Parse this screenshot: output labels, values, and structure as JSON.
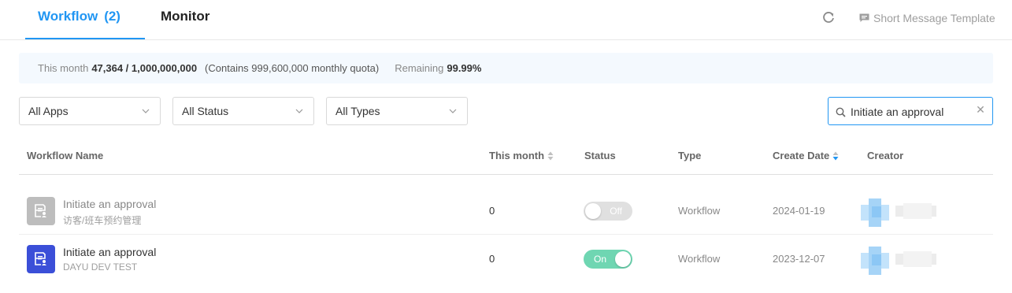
{
  "tabs": {
    "workflow_label": "Workflow",
    "workflow_count": "(2)",
    "monitor_label": "Monitor"
  },
  "header": {
    "short_message_template": "Short Message Template"
  },
  "quota": {
    "this_month_label": "This month",
    "usage": "47,364 / 1,000,000,000",
    "contains": "(Contains 999,600,000 monthly quota)",
    "remaining_label": "Remaining",
    "remaining_value": "99.99%"
  },
  "filters": {
    "apps": "All Apps",
    "status": "All Status",
    "types": "All Types"
  },
  "search": {
    "value": "Initiate an approval"
  },
  "table": {
    "columns": {
      "name": "Workflow Name",
      "this_month": "This month",
      "status": "Status",
      "type": "Type",
      "create_date": "Create Date",
      "creator": "Creator"
    },
    "rows": [
      {
        "name": "Initiate an approval",
        "app": "访客/班车预约管理",
        "count": "0",
        "status": "Off",
        "type": "Workflow",
        "date": "2024-01-19"
      },
      {
        "name": "Initiate an approval",
        "app": "DAYU DEV TEST",
        "count": "0",
        "status": "On",
        "type": "Workflow",
        "date": "2023-12-07"
      }
    ]
  },
  "colors": {
    "accent": "#2196f3",
    "toggle_on": "#6fd6b2",
    "toggle_off": "#e0e0e0",
    "app_icon_active": "#3b4fd8",
    "app_icon_inactive": "#bdbdbd"
  },
  "icons": {
    "refresh": "refresh-icon",
    "message": "message-icon",
    "search": "search-icon",
    "clear": "close-icon",
    "chevron": "chevron-down-icon",
    "sort": "sort-icon",
    "app": "document-user-icon"
  }
}
